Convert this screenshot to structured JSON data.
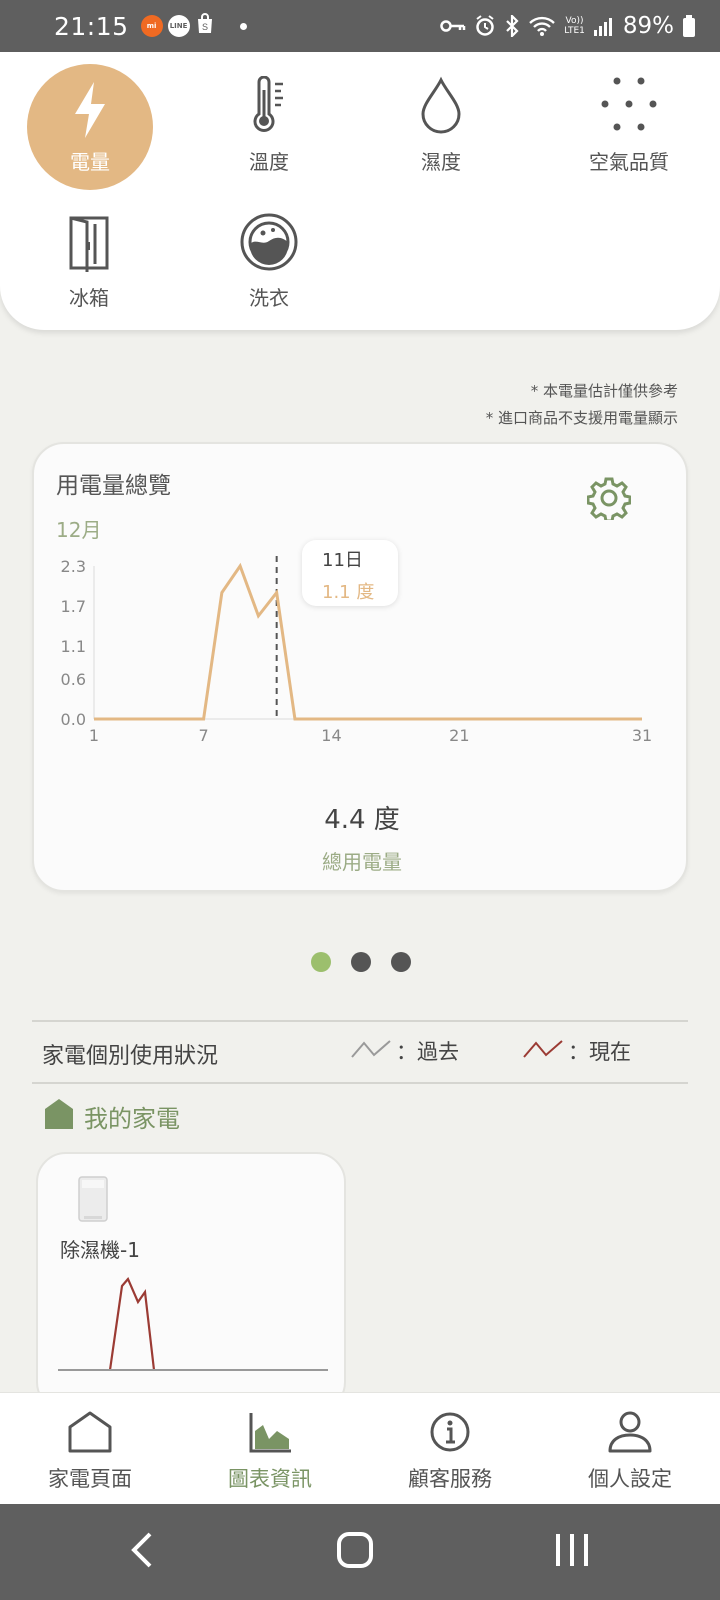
{
  "status_bar": {
    "time": "21:15",
    "battery": "89%",
    "network": "LTE1"
  },
  "categories": [
    {
      "label": "電量",
      "icon": "lightning-icon",
      "active": true
    },
    {
      "label": "溫度",
      "icon": "thermometer-icon",
      "active": false
    },
    {
      "label": "濕度",
      "icon": "droplet-icon",
      "active": false
    },
    {
      "label": "空氣品質",
      "icon": "air-quality-icon",
      "active": false
    },
    {
      "label": "冰箱",
      "icon": "fridge-icon",
      "active": false
    },
    {
      "label": "洗衣",
      "icon": "washer-icon",
      "active": false
    }
  ],
  "notes": {
    "line1": "* 本電量估計僅供參考",
    "line2": "* 進口商品不支援用電量顯示"
  },
  "overview": {
    "title": "用電量總覽",
    "month": "12月",
    "tooltip_day": "11日",
    "tooltip_value": "1.1 度",
    "total_value": "4.4 度",
    "total_label": "總用電量"
  },
  "chart_data": {
    "type": "line",
    "x": [
      1,
      7,
      8,
      9,
      10,
      11,
      12,
      31
    ],
    "y": [
      0,
      0,
      1.9,
      2.3,
      1.55,
      1.9,
      0,
      0
    ],
    "xticks": [
      "1",
      "7",
      "14",
      "21",
      "31"
    ],
    "xtick_values": [
      1,
      7,
      14,
      21,
      31
    ],
    "yticks": [
      "0.0",
      "0.6",
      "1.1",
      "1.7",
      "2.3"
    ],
    "ytick_values": [
      0,
      0.6,
      1.1,
      1.7,
      2.3
    ],
    "ylim": [
      0,
      2.3
    ],
    "xlim": [
      1,
      31
    ],
    "highlight_x": 11,
    "line_color": "#e3b884"
  },
  "pager": {
    "count": 3,
    "active": 0
  },
  "section": {
    "title": "家電個別使用狀況",
    "legend_past": "：過去",
    "legend_now": "：現在",
    "legend_past_color": "#9a9a9a",
    "legend_now_color": "#9b3b34"
  },
  "my_appliances": {
    "title": "我的家電",
    "items": [
      {
        "name": "除濕機-1"
      }
    ]
  },
  "bottom_nav": [
    {
      "label": "家電頁面",
      "icon": "house-icon",
      "active": false
    },
    {
      "label": "圖表資訊",
      "icon": "area-chart-icon",
      "active": true
    },
    {
      "label": "顧客服務",
      "icon": "info-icon",
      "active": false
    },
    {
      "label": "個人設定",
      "icon": "user-icon",
      "active": false
    }
  ],
  "colors": {
    "accent": "#e3b884",
    "green": "#9cac86",
    "dark_green": "#7a9464"
  }
}
